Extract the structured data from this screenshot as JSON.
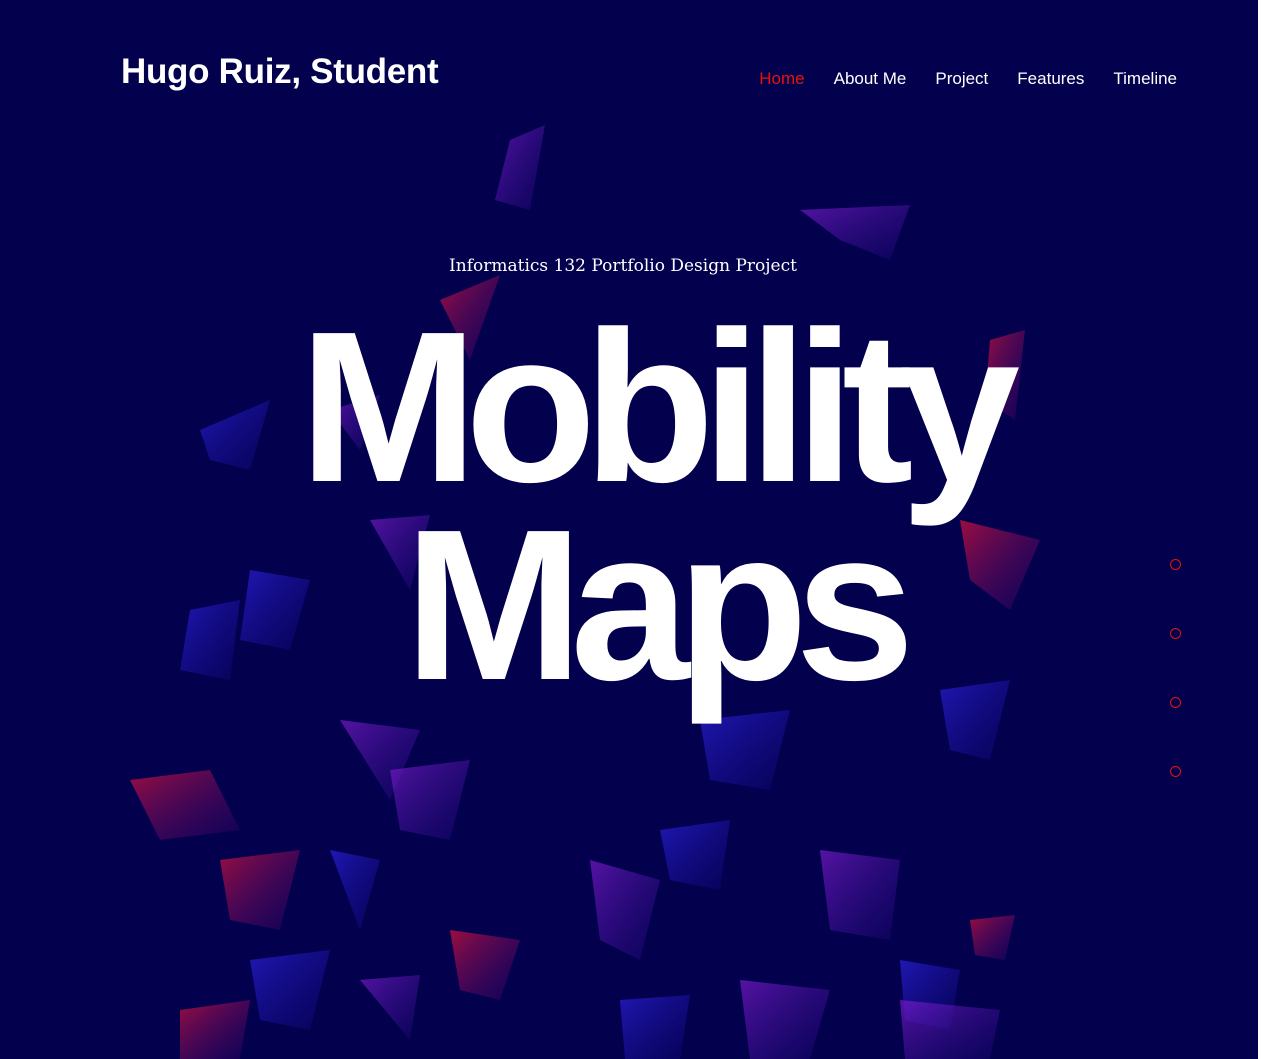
{
  "header": {
    "site_title": "Hugo Ruiz, Student"
  },
  "nav": {
    "items": [
      {
        "label": "Home",
        "active": true
      },
      {
        "label": "About Me",
        "active": false
      },
      {
        "label": "Project",
        "active": false
      },
      {
        "label": "Features",
        "active": false
      },
      {
        "label": "Timeline",
        "active": false
      }
    ]
  },
  "hero": {
    "subtitle": "Informatics 132 Portfolio Design Project",
    "title_line_1": "Mobility",
    "title_line_2": "Maps"
  },
  "section_dots": {
    "count": 4,
    "style": "outlined-circle"
  },
  "colors": {
    "background": "#03004d",
    "accent": "#e8120c",
    "text": "#ffffff",
    "art_blue": "#2a1fd6",
    "art_purple": "#6a1bb8",
    "art_red": "#c4123a"
  }
}
